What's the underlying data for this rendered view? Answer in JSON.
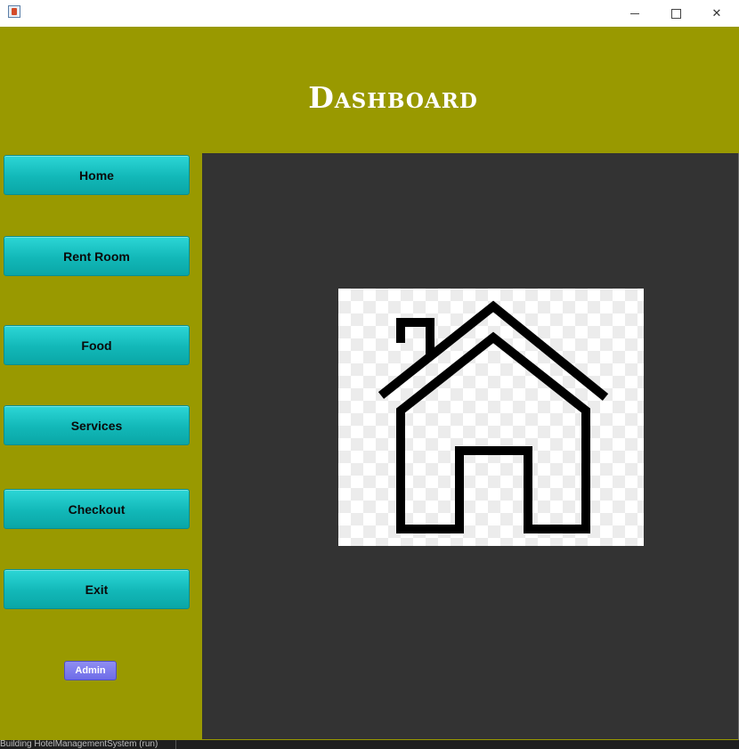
{
  "window": {
    "icon": "java-app-icon",
    "controls": {
      "minimize_icon": "minimize-icon",
      "maximize_icon": "maximize-icon",
      "close_icon": "close-icon"
    }
  },
  "header": {
    "title": "Dashboard",
    "background": "#999900"
  },
  "sidebar": {
    "background": "#999900",
    "items": [
      {
        "label": "Home"
      },
      {
        "label": "Rent Room"
      },
      {
        "label": "Food"
      },
      {
        "label": "Services"
      },
      {
        "label": "Checkout"
      },
      {
        "label": "Exit"
      }
    ],
    "admin_button": "Admin",
    "button_color": "#12b8b8",
    "admin_color": "#7b7aee"
  },
  "content": {
    "background": "#333333",
    "image_icon": "house-icon"
  },
  "statusbar": {
    "text": "Building HotelManagementSystem (run)"
  }
}
